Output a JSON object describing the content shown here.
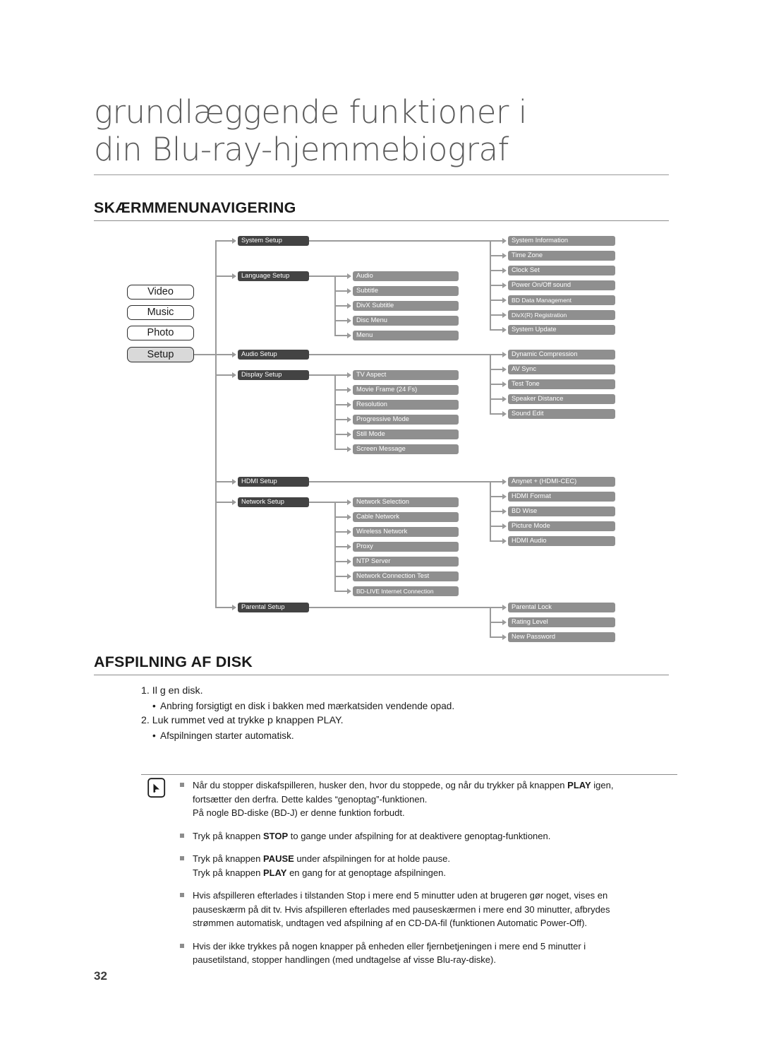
{
  "header": {
    "chapter_title": "grundlæggende funktioner i\ndin Blu-ray-hjemmebiograf",
    "sections": [
      {
        "id": "menu-nav",
        "title": "SKÆRMMENUNAVIGERING"
      },
      {
        "id": "disc-play",
        "title": "AFSPILNING AF DISK"
      }
    ]
  },
  "diagram": {
    "root_items": [
      {
        "label": "Video",
        "active": false
      },
      {
        "label": "Music",
        "active": false
      },
      {
        "label": "Photo",
        "active": false
      },
      {
        "label": "Setup",
        "active": true
      }
    ],
    "branches": [
      {
        "label": "System Setup",
        "children": [
          "System Information",
          "Time Zone",
          "Clock Set",
          "Power On/Off sound",
          "BD Data Management",
          "DivX(R) Registration",
          "System Update"
        ]
      },
      {
        "label": "Language Setup",
        "children": [
          "Audio",
          "Subtitle",
          "DivX Subtitle",
          "Disc Menu",
          "Menu"
        ]
      },
      {
        "label": "Audio Setup",
        "children": [
          "Dynamic Compression",
          "AV Sync",
          "Test Tone",
          "Speaker Distance",
          "Sound Edit"
        ]
      },
      {
        "label": "Display Setup",
        "children": [
          "TV Aspect",
          "Movie Frame (24 Fs)",
          "Resolution",
          "Progressive Mode",
          "Still Mode",
          "Screen Message"
        ]
      },
      {
        "label": "HDMI Setup",
        "children": [
          "Anynet + (HDMI-CEC)",
          "HDMI Format",
          "BD Wise",
          "Picture Mode",
          "HDMI Audio"
        ]
      },
      {
        "label": "Network Setup",
        "children": [
          "Network Selection",
          "Cable Network",
          "Wireless Network",
          "Proxy",
          "NTP Server",
          "Network Connection Test",
          "BD-LIVE Internet Connection"
        ]
      },
      {
        "label": "Parental Setup",
        "children": [
          "Parental Lock",
          "Rating Level",
          "New Password"
        ]
      }
    ]
  },
  "playback": {
    "steps": [
      {
        "number": "1.",
        "text": "Il g en disk.",
        "bullets": [
          "Anbring forsigtigt en disk i bakken med mærkatsiden vendende opad."
        ]
      },
      {
        "number": "2.",
        "text": "Luk rummet ved at trykke p  knappen PLAY.",
        "bullets": [
          "Afspilningen starter automatisk."
        ]
      }
    ]
  },
  "notes": {
    "icon": "memo-pencil-icon",
    "items": [
      {
        "lines": [
          [
            {
              "t": "Når du stopper diskafspilleren, husker den, hvor du stoppede, og når du trykker på knappen ",
              "b": false
            },
            {
              "t": "PLAY",
              "b": true
            },
            {
              "t": " igen,",
              "b": false
            }
          ],
          [
            {
              "t": "fortsætter den derfra. Dette kaldes “genoptag”-funktionen.",
              "b": false
            }
          ],
          [
            {
              "t": "På nogle BD-diske (BD-J) er denne funktion forbudt.",
              "b": false
            }
          ]
        ]
      },
      {
        "lines": [
          [
            {
              "t": "Tryk på knappen ",
              "b": false
            },
            {
              "t": "STOP",
              "b": true
            },
            {
              "t": " to gange under afspilning for at deaktivere genoptag-funktionen.",
              "b": false
            }
          ]
        ]
      },
      {
        "lines": [
          [
            {
              "t": "Tryk på knappen ",
              "b": false
            },
            {
              "t": "PAUSE",
              "b": true
            },
            {
              "t": " under afspilningen for at holde pause.",
              "b": false
            }
          ],
          [
            {
              "t": "Tryk på knappen ",
              "b": false
            },
            {
              "t": "PLAY",
              "b": true
            },
            {
              "t": " en gang for at genoptage afspilningen.",
              "b": false
            }
          ]
        ]
      },
      {
        "lines": [
          [
            {
              "t": "Hvis afspilleren efterlades i tilstanden Stop i mere end 5 minutter uden at brugeren gør noget, vises en",
              "b": false
            }
          ],
          [
            {
              "t": "pauseskærm på dit tv. Hvis afspilleren efterlades med pauseskærmen i mere end 30 minutter, afbrydes",
              "b": false
            }
          ],
          [
            {
              "t": "strømmen automatisk, undtagen ved afspilning af en CD-DA-fil (funktionen Automatic Power-Off).",
              "b": false
            }
          ]
        ]
      },
      {
        "lines": [
          [
            {
              "t": "Hvis der ikke trykkes på nogen knapper på enheden eller fjernbetjeningen i mere end 5 minutter i",
              "b": false
            }
          ],
          [
            {
              "t": "pausetilstand, stopper handlingen (med undtagelse af visse Blu-ray-diske).",
              "b": false
            }
          ]
        ]
      }
    ]
  },
  "footer": {
    "page_number": "32"
  }
}
